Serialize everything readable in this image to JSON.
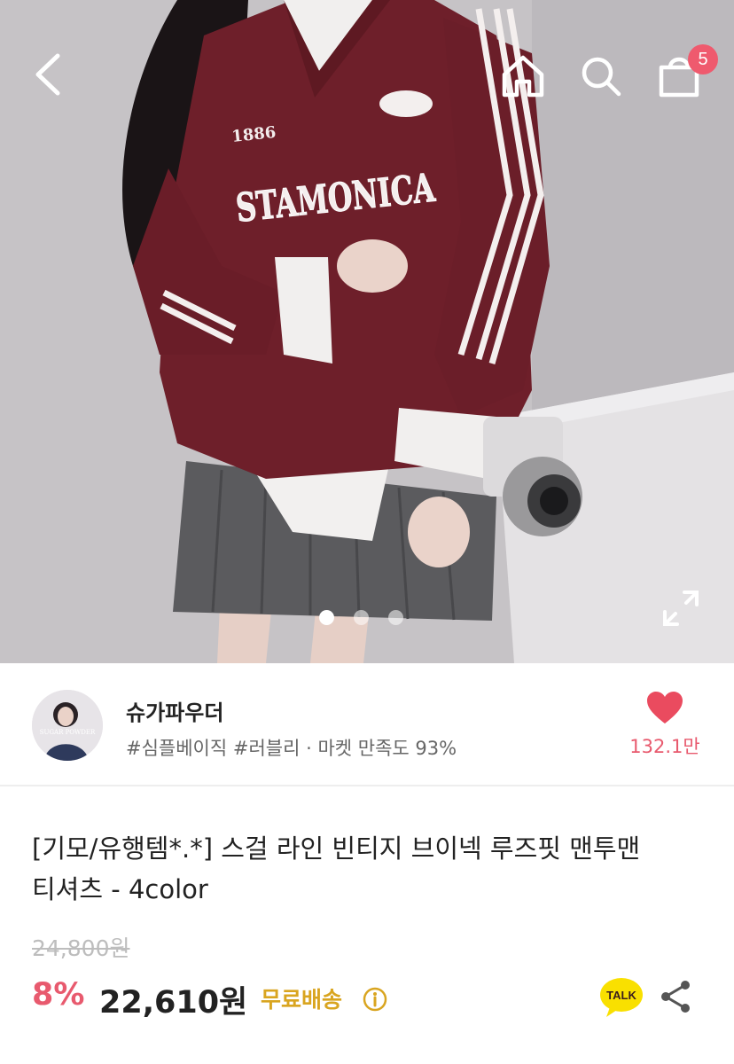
{
  "header": {
    "back_icon": "chevron-left-icon",
    "home_icon": "home-icon",
    "search_icon": "search-icon",
    "cart_icon": "shopping-bag-icon",
    "cart_count": "5"
  },
  "gallery": {
    "image_count": 3,
    "active_index": 0,
    "expand_icon": "expand-icon",
    "sweater_print": {
      "year": "1886",
      "wordmark": "STAMONICA"
    }
  },
  "shop": {
    "name": "슈가파우더",
    "tags": "#심플베이직 #러블리 · 마켓 만족도 93%",
    "like_count": "132.1만",
    "avatar_text": "SUGAR POWDER"
  },
  "product": {
    "title_line1": "[기모/유행템*.*] 스걸 라인 빈티지 브이넥 루즈핏 맨투맨",
    "title_line2": "티셔츠 - 4color",
    "original_price": "24,800원",
    "discount": "8%",
    "price": "22,610원",
    "shipping": "무료배송",
    "talk_label": "TALK"
  },
  "colors": {
    "accent_pink": "#e85a6e",
    "badge_pink": "#ef5a6e",
    "shipping_gold": "#d9a520",
    "kakao_yellow": "#f9e000"
  }
}
